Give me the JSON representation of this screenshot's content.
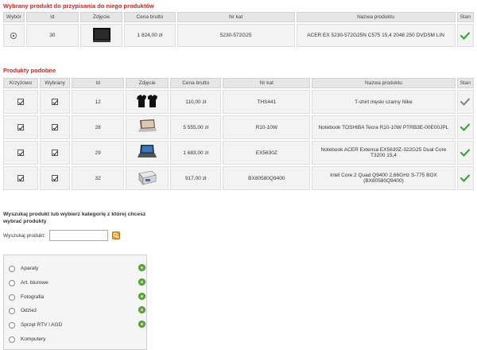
{
  "selected": {
    "title": "Wybrany produkt do przypisania do niego produktów",
    "headers": [
      "Wybór",
      "Id",
      "Zdjęcie",
      "Cena brutto",
      "Nr kat",
      "Nazwa produktu",
      "Stan"
    ],
    "row": {
      "id": "30",
      "image_icon": "laptop-thumbnail",
      "price": "1 824,00 zł",
      "catalog_no": "5230-572G25",
      "name": "ACER EX 5230-572G25N C575 15,4 2048 250 DVDSM LIN",
      "status_icon": "check-icon"
    }
  },
  "similar": {
    "title": "Produkty podobne",
    "headers": [
      "Krzyżowo",
      "Wybrany",
      "Id",
      "Zdjęcie",
      "Cena brutto",
      "Nr kat",
      "Nazwa produktu",
      "Stan"
    ],
    "rows": [
      {
        "id": "12",
        "image_icon": "tshirt-thumbnail",
        "price": "110,00 zł",
        "catalog_no": "THS441",
        "name": "T-shirt męski czarny Nike",
        "status": "check-gray"
      },
      {
        "id": "28",
        "image_icon": "laptop-thumbnail",
        "price": "5 555,00 zł",
        "catalog_no": "R10-10W",
        "name": "Notebook TOSHIBA Tecra R10-10W PTRB3E-00E00JPL",
        "status": "check-green"
      },
      {
        "id": "29",
        "image_icon": "laptop-thumbnail",
        "price": "1 683,00 zł",
        "catalog_no": "EX5630Z",
        "name": "Notebook ACER Extensa EX5630Z-322G25 Dual Core T3200 15,4",
        "status": "check-green"
      },
      {
        "id": "32",
        "image_icon": "cpu-box-thumbnail",
        "price": "917,00 zł",
        "catalog_no": "BX80580Q9400",
        "name": "Intel Core 2 Quad Q9400 2,66GHz S-775 BOX (BX80580Q9400)",
        "status": "check-green"
      }
    ]
  },
  "search": {
    "heading": "Wyszukaj produkt lub wybierz kategorię z której chcesz wybrać produkty",
    "label": "Wyszukaj produkt:",
    "value": "",
    "button_icon": "search-icon"
  },
  "categories": [
    "Aparaty",
    "Art. biurowe",
    "Fotografia",
    "Odzież",
    "Sprzęt RTV i AGD",
    "Komputery"
  ],
  "colors": {
    "accent": "#cc2222",
    "check_green": "#3aa63a",
    "check_gray": "#8a8a8a"
  }
}
